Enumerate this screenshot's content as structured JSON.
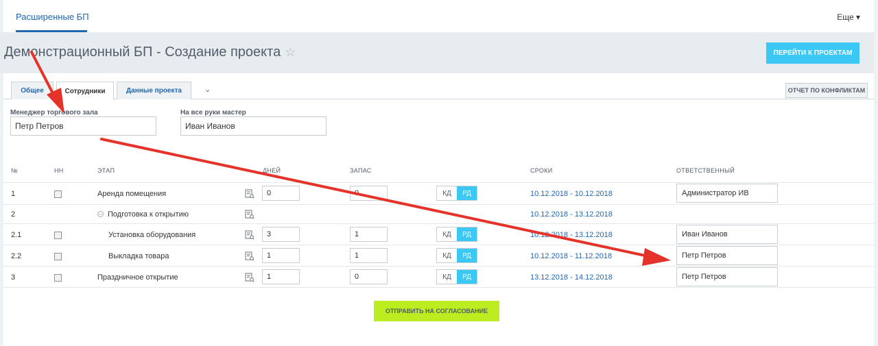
{
  "topbar": {
    "brand": "Расширенные БП",
    "more": "Еще ▾"
  },
  "header": {
    "title": "Демонстрационный БП - Создание проекта",
    "star": "☆",
    "projects_button": "ПЕРЕЙТИ К ПРОЕКТАМ"
  },
  "tabs": [
    {
      "label": "Общее"
    },
    {
      "label": "Сотрудники"
    },
    {
      "label": "Данные проекта"
    }
  ],
  "tabs_more": "⌄",
  "report_button": "ОТЧЕТ ПО КОНФЛИКТАМ",
  "fields": {
    "manager_label": "Менеджер торгового зала",
    "manager_value": "Петр Петров",
    "master_label": "На все руки мастер",
    "master_value": "Иван Иванов"
  },
  "table": {
    "headers": {
      "num": "№",
      "nn": "НН",
      "stage": "ЭТАП",
      "days": "ДНЕЙ",
      "reserve": "ЗАПАС",
      "dates": "СРОКИ",
      "responsible": "ОТВЕТСТВЕННЫЙ"
    },
    "toggle": {
      "kd": "КД",
      "rd": "РД"
    },
    "rows": [
      {
        "num": "1",
        "stage": "Аренда помещения",
        "days": "0",
        "reserve": "0",
        "dates": "10.12.2018 - 10.12.2018",
        "responsible": "Администратор ИВ"
      },
      {
        "num": "2",
        "stage": "Подготовка к открытию",
        "dates": "10.12.2018 - 13.12.2018"
      },
      {
        "num": "2.1",
        "stage": "Установка оборудования",
        "days": "3",
        "reserve": "1",
        "dates": "10.12.2018 - 13.12.2018",
        "responsible": "Иван Иванов"
      },
      {
        "num": "2.2",
        "stage": "Выкладка товара",
        "days": "1",
        "reserve": "1",
        "dates": "10.12.2018 - 11.12.2018",
        "responsible": "Петр Петров"
      },
      {
        "num": "3",
        "stage": "Праздничное открытие",
        "days": "1",
        "reserve": "0",
        "dates": "13.12.2018 - 14.12.2018",
        "responsible": "Петр Петров"
      }
    ]
  },
  "submit_button": "ОТПРАВИТЬ НА СОГЛАСОВАНИЕ",
  "colors": {
    "accent": "#3bc8f5",
    "submit": "#bbed21",
    "link": "#2067b0",
    "annotation_arrow": "#e5332a"
  }
}
